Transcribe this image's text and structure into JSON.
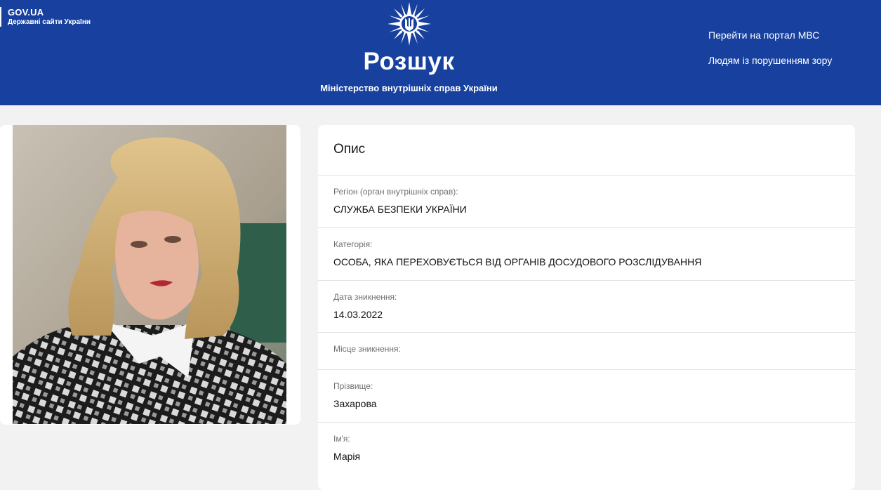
{
  "header": {
    "gov_title": "GOV.UA",
    "gov_subtitle": "Державні сайти України",
    "emblem_icon": "police-emblem-icon",
    "title": "Розшук",
    "subtitle": "Міністерство внутрішніх справ України",
    "links": [
      "Перейти на портал МВС",
      "Людям із порушенням зору"
    ]
  },
  "colors": {
    "header_bg": "#17409f",
    "page_bg": "#f2f2f2"
  },
  "description": {
    "title": "Опис",
    "fields": [
      {
        "label": "Регіон (орган внутрішніх справ):",
        "value": "СЛУЖБА БЕЗПЕКИ УКРАЇНИ"
      },
      {
        "label": "Категорія:",
        "value": "ОСОБА, ЯКА ПЕРЕХОВУЄТЬСЯ ВІД ОРГАНІВ ДОСУДОВОГО РОЗСЛІДУВАННЯ"
      },
      {
        "label": "Дата зникнення:",
        "value": "14.03.2022"
      },
      {
        "label": "Місце зникнення:",
        "value": ""
      },
      {
        "label": "Прізвище:",
        "value": "Захарова"
      },
      {
        "label": "Ім'я:",
        "value": "Марія"
      }
    ]
  }
}
